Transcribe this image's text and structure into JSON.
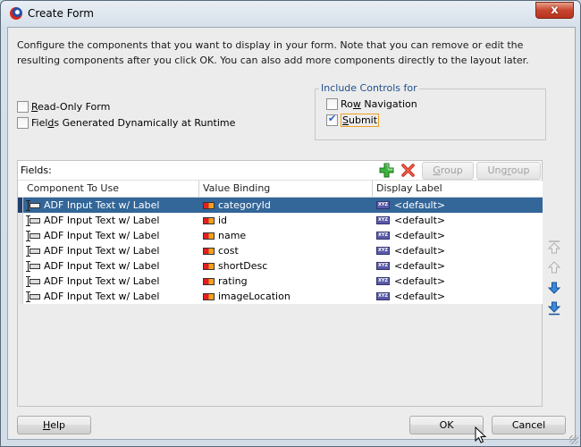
{
  "window": {
    "title": "Create Form",
    "close_label": "x"
  },
  "intro_text": "Configure the components that you want to display in your form. Note that you can remove or edit the resulting components after you click OK. You can also add more components directly to the layout later.",
  "options": {
    "read_only_form": {
      "label_pre": "",
      "mnemonic": "R",
      "label_post": "ead-Only Form",
      "checked": false
    },
    "fields_dynamic": {
      "label_pre": "Fiel",
      "mnemonic": "d",
      "label_post": "s Generated Dynamically at Runtime",
      "checked": false
    }
  },
  "include_controls": {
    "legend": "Include Controls for",
    "row_navigation": {
      "label_pre": "Ro",
      "mnemonic": "w",
      "label_post": " Navigation",
      "checked": false
    },
    "submit": {
      "label_pre": "",
      "mnemonic": "S",
      "label_post": "ubmit",
      "checked": true
    }
  },
  "fields": {
    "label": "Fields:",
    "add_icon": "add-icon",
    "delete_icon": "delete-icon",
    "group_button": {
      "pre": "",
      "mnemonic": "G",
      "post": "roup"
    },
    "ungroup_button": {
      "pre": "Ung",
      "mnemonic": "r",
      "post": "oup"
    },
    "columns": [
      "Component To Use",
      "Value Binding",
      "Display Label"
    ],
    "rows": [
      {
        "component": "ADF Input Text w/ Label",
        "binding": "categoryId",
        "label": "<default>",
        "selected": true
      },
      {
        "component": "ADF Input Text w/ Label",
        "binding": "id",
        "label": "<default>",
        "selected": false
      },
      {
        "component": "ADF Input Text w/ Label",
        "binding": "name",
        "label": "<default>",
        "selected": false
      },
      {
        "component": "ADF Input Text w/ Label",
        "binding": "cost",
        "label": "<default>",
        "selected": false
      },
      {
        "component": "ADF Input Text w/ Label",
        "binding": "shortDesc",
        "label": "<default>",
        "selected": false
      },
      {
        "component": "ADF Input Text w/ Label",
        "binding": "rating",
        "label": "<default>",
        "selected": false
      },
      {
        "component": "ADF Input Text w/ Label",
        "binding": "imageLocation",
        "label": "<default>",
        "selected": false
      }
    ]
  },
  "reorder": [
    "move-to-top-icon",
    "move-up-icon",
    "move-down-icon",
    "move-to-bottom-icon"
  ],
  "footer": {
    "help": {
      "pre": "",
      "mnemonic": "H",
      "post": "elp"
    },
    "ok": "OK",
    "cancel": "Cancel"
  },
  "colors": {
    "selection": "#336699",
    "focus": "#f0a020",
    "legend_text": "#1f4f8a"
  }
}
